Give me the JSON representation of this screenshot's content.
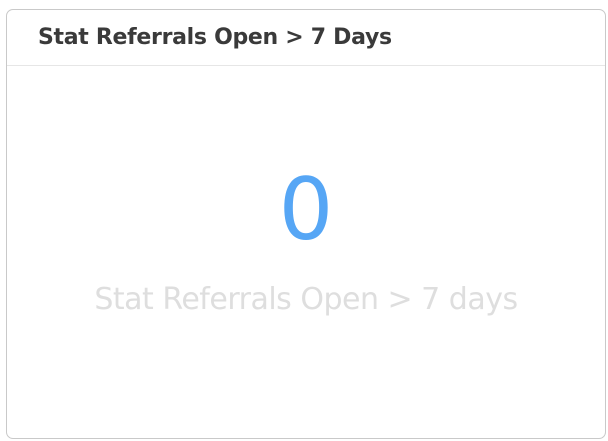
{
  "widget": {
    "title": "Stat Referrals Open > 7 Days",
    "value": "0",
    "caption": "Stat Referrals Open > 7 days"
  },
  "colors": {
    "value": "#56a6f5",
    "caption": "#dedede",
    "title": "#3a3a3a",
    "border": "#c9c9c9"
  }
}
